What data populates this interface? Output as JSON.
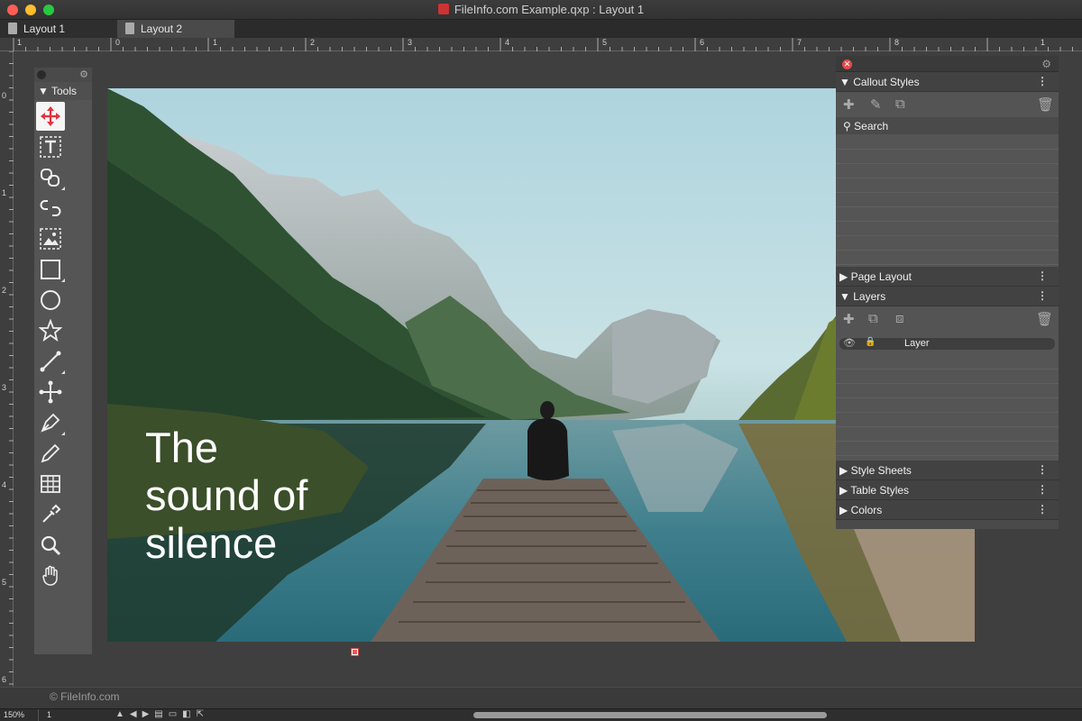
{
  "window": {
    "title": "FileInfo.com Example.qxp : Layout 1"
  },
  "tabs": [
    {
      "label": "Layout 1"
    },
    {
      "label": "Layout 2"
    }
  ],
  "ruler": {
    "horizontal": [
      "1",
      "0",
      "1",
      "2",
      "3",
      "4",
      "5",
      "6",
      "7",
      "8",
      "1"
    ],
    "vertical": [
      "0",
      "1",
      "2",
      "3",
      "4",
      "5",
      "6"
    ]
  },
  "tools_panel": {
    "title": "Tools",
    "tools": [
      "item-tool",
      "text-content-tool",
      "text-linking-tool",
      "text-unlinking-tool",
      "picture-content-tool",
      "rectangle-box-tool",
      "oval-box-tool",
      "starburst-tool",
      "line-tool",
      "orthogonal-line-tool",
      "bezier-pen-tool",
      "freehand-tool",
      "table-tool",
      "eyedropper-tool",
      "zoom-tool",
      "pan-tool"
    ]
  },
  "page": {
    "text_lines": [
      "The",
      "sound of",
      "silence"
    ]
  },
  "right_panel": {
    "callout_styles": {
      "title": "Callout Styles",
      "search_label": "Search"
    },
    "page_layout": {
      "title": "Page Layout"
    },
    "layers": {
      "title": "Layers",
      "layer_name": "Layer"
    },
    "style_sheets": {
      "title": "Style Sheets"
    },
    "table_styles": {
      "title": "Table Styles"
    },
    "colors": {
      "title": "Colors"
    }
  },
  "status": {
    "copyright": "© FileInfo.com",
    "zoom": "150%",
    "page": "1"
  }
}
